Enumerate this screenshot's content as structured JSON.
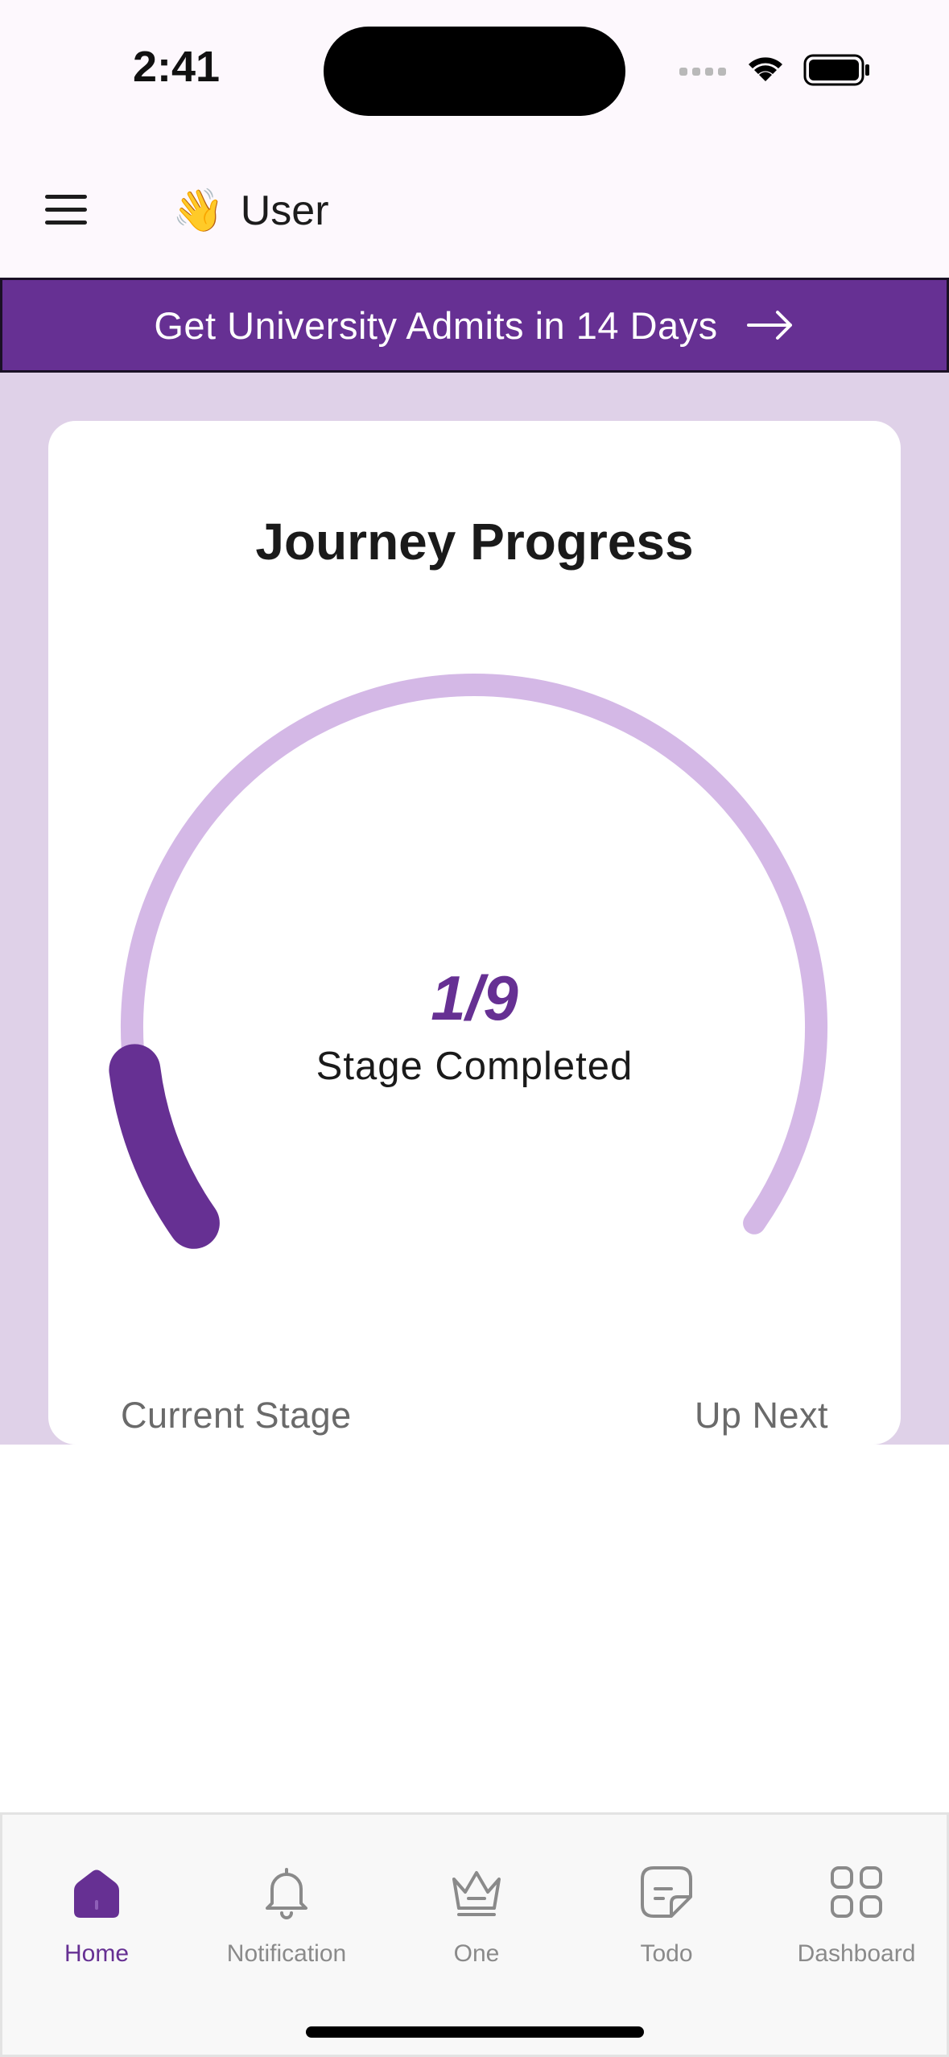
{
  "status_bar": {
    "time": "2:41"
  },
  "header": {
    "greeting_emoji": "👋",
    "user_name": "User"
  },
  "banner": {
    "text": "Get University Admits in 14 Days"
  },
  "journey_card": {
    "title": "Journey Progress",
    "completed": 1,
    "total": 9,
    "progress_text": "1/9",
    "progress_label": "Stage Completed",
    "current_stage_label": "Current Stage",
    "up_next_label": "Up Next"
  },
  "colors": {
    "brand": "#663093",
    "track": "#d4b8e6",
    "background_tint": "#dfd1e8"
  },
  "tabs": [
    {
      "label": "Home",
      "icon": "home-icon",
      "active": true
    },
    {
      "label": "Notification",
      "icon": "bell-icon",
      "active": false
    },
    {
      "label": "One",
      "icon": "crown-icon",
      "active": false
    },
    {
      "label": "Todo",
      "icon": "note-icon",
      "active": false
    },
    {
      "label": "Dashboard",
      "icon": "grid-icon",
      "active": false
    }
  ]
}
